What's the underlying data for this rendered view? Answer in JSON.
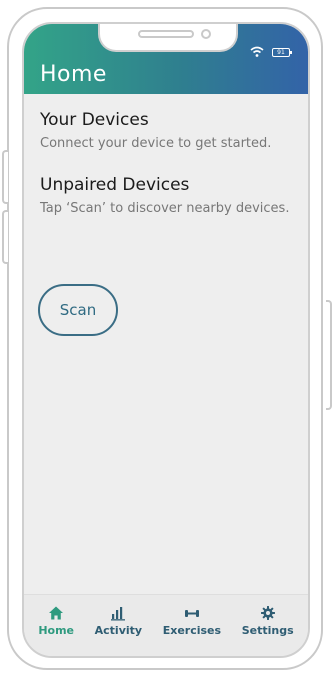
{
  "status_bar": {
    "battery": "91"
  },
  "header": {
    "title": "Home"
  },
  "sections": [
    {
      "title": "Your Devices",
      "subtitle": "Connect your device to get started."
    },
    {
      "title": "Unpaired Devices",
      "subtitle": "Tap ‘Scan’ to discover nearby devices."
    }
  ],
  "scan_button": {
    "label": "Scan"
  },
  "tabs": [
    {
      "label": "Home",
      "icon": "home-icon",
      "active": true
    },
    {
      "label": "Activity",
      "icon": "bar-chart-icon",
      "active": false
    },
    {
      "label": "Exercises",
      "icon": "dumbbell-icon",
      "active": false
    },
    {
      "label": "Settings",
      "icon": "gear-icon",
      "active": false
    }
  ],
  "colors": {
    "header_start": "#33a488",
    "header_end": "#3363a8",
    "accent": "#2f9a7f",
    "tab_inactive": "#2f5d73"
  }
}
